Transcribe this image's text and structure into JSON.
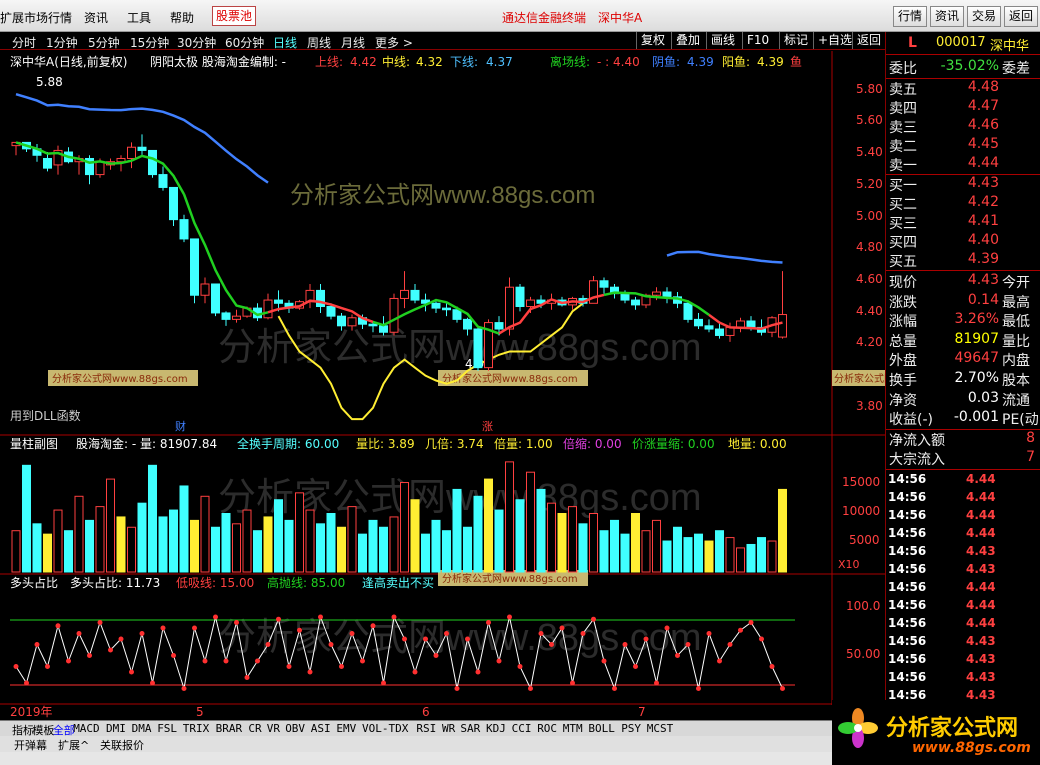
{
  "menu": {
    "items": [
      "扩展市场行情",
      "资讯",
      "工具",
      "帮助"
    ],
    "hot": "股票池",
    "center_app": "通达信金融终端",
    "center_stock": "深中华A",
    "right_btns": [
      "行情",
      "资讯",
      "交易",
      "返回"
    ]
  },
  "toolbar": {
    "periods": [
      "分时",
      "1分钟",
      "5分钟",
      "15分钟",
      "30分钟",
      "60分钟",
      "日线",
      "周线",
      "月线",
      "更多 >"
    ],
    "selected": "日线",
    "right": [
      "复权",
      "叠加",
      "画线",
      "F10",
      "标记",
      "+自选",
      "返回"
    ]
  },
  "main_title": {
    "name": "深中华A(日线,前复权)",
    "formula": "阴阳太极  股海淘金编制: -",
    "upper_label": "上线:",
    "upper": "4.42",
    "mid_label": "中线:",
    "mid": "4.32",
    "lower_label": "下线:",
    "lower": "4.37",
    "exit_label": "离场线:",
    "exit": "- : 4.40",
    "yin_label": "阴鱼:",
    "yin": "4.39",
    "yang_label": "阳鱼:",
    "yang": "4.39",
    "fish": "鱼"
  },
  "price_axis": [
    "5.80",
    "5.60",
    "5.40",
    "5.20",
    "5.00",
    "4.80",
    "4.60",
    "4.40",
    "4.20",
    "3.80"
  ],
  "annotations": {
    "high": "5.88",
    "low": "4.08",
    "dll": "用到DLL函数",
    "cai": "财",
    "zhang": "涨"
  },
  "watermark": {
    "text": "分析家公式网www.88gs.com",
    "big1": "分析家公式网www.88gs.com",
    "big2": "分析家公式网www.88gs.com",
    "small": "分析家公式网www.88gs.com"
  },
  "volume_title": {
    "name": "量柱副图",
    "formula": "股海淘金: - 量: 81907.84",
    "period": "全换手周期: 60.00",
    "ratio": "量比: 3.89",
    "times": "几倍: 3.74",
    "bei": "倍量: 1.00",
    "suo": "倍缩: 0.00",
    "jzl": "价涨量缩: 0.00",
    "dl": "地量: 0.00"
  },
  "volume_axis": [
    "15000",
    "10000",
    "5000"
  ],
  "volume_unit": "X10",
  "osc_title": {
    "name": "多头占比",
    "label": "多头占比: 11.73",
    "low": "低吸线: 15.00",
    "high": "高抛线: 85.00",
    "tip": "逢高卖出不买"
  },
  "osc_axis": [
    "100.0",
    "50.00"
  ],
  "dates": [
    "2019年",
    "5",
    "6",
    "7"
  ],
  "tabs": [
    "指标",
    "模板",
    "全部",
    "MACD",
    "DMI",
    "DMA",
    "FSL",
    "TRIX",
    "BRAR",
    "CR",
    "VR",
    "OBV",
    "ASI",
    "EMV",
    "VOL-TDX",
    "RSI",
    "WR",
    "SAR",
    "KDJ",
    "CCI",
    "ROC",
    "MTM",
    "BOLL",
    "PSY",
    "MCST"
  ],
  "tabs_active": "全部",
  "tabs2": [
    "开弹幕",
    "扩展^",
    "关联报价"
  ],
  "quote": {
    "code": "000017",
    "name": "深中华",
    "flag": "L",
    "weibi_label": "委比",
    "weibi": "-35.02%",
    "weicha": "委差",
    "asks": [
      {
        "l": "卖五",
        "p": "4.48"
      },
      {
        "l": "卖四",
        "p": "4.47"
      },
      {
        "l": "卖三",
        "p": "4.46"
      },
      {
        "l": "卖二",
        "p": "4.45"
      },
      {
        "l": "卖一",
        "p": "4.44"
      }
    ],
    "bids": [
      {
        "l": "买一",
        "p": "4.43"
      },
      {
        "l": "买二",
        "p": "4.42"
      },
      {
        "l": "买三",
        "p": "4.41"
      },
      {
        "l": "买四",
        "p": "4.40"
      },
      {
        "l": "买五",
        "p": "4.39"
      }
    ],
    "stats": [
      {
        "l": "现价",
        "v": "4.43",
        "c": "red",
        "x": "今开"
      },
      {
        "l": "涨跌",
        "v": "0.14",
        "c": "red",
        "x": "最高"
      },
      {
        "l": "涨幅",
        "v": "3.26%",
        "c": "red",
        "x": "最低"
      },
      {
        "l": "总量",
        "v": "81907",
        "c": "yel",
        "x": "量比"
      },
      {
        "l": "外盘",
        "v": "49647",
        "c": "red",
        "x": "内盘"
      },
      {
        "l": "换手",
        "v": "2.70%",
        "c": "wht",
        "x": "股本"
      },
      {
        "l": "净资",
        "v": "0.03",
        "c": "wht",
        "x": "流通"
      },
      {
        "l": "收益(-)",
        "v": "-0.001",
        "c": "wht",
        "x": "PE(动"
      }
    ],
    "flows": [
      {
        "l": "净流入额",
        "v": "8"
      },
      {
        "l": "大宗流入",
        "v": "7"
      }
    ],
    "ticks": [
      {
        "t": "14:56",
        "p": "4.44"
      },
      {
        "t": "14:56",
        "p": "4.44"
      },
      {
        "t": "14:56",
        "p": "4.44"
      },
      {
        "t": "14:56",
        "p": "4.44"
      },
      {
        "t": "14:56",
        "p": "4.43"
      },
      {
        "t": "14:56",
        "p": "4.43"
      },
      {
        "t": "14:56",
        "p": "4.44"
      },
      {
        "t": "14:56",
        "p": "4.44"
      },
      {
        "t": "14:56",
        "p": "4.44"
      },
      {
        "t": "14:56",
        "p": "4.43"
      },
      {
        "t": "14:56",
        "p": "4.43"
      },
      {
        "t": "14:56",
        "p": "4.43"
      },
      {
        "t": "14:56",
        "p": "4.43"
      },
      {
        "t": "14:56",
        "p": "4.43"
      }
    ]
  },
  "logo": {
    "cn": "分析家公式网",
    "url": "www.88gs.com"
  },
  "colors": {
    "up": "#ff4040",
    "down": "#40ffff",
    "blue": "#4080ff",
    "green": "#20d020",
    "yellow": "#ffee33"
  },
  "chart_data": {
    "type": "candlestick",
    "ylim": [
      3.7,
      5.95
    ],
    "candles": [
      [
        5.48,
        5.5,
        5.42,
        5.5
      ],
      [
        5.5,
        5.5,
        5.44,
        5.46
      ],
      [
        5.46,
        5.49,
        5.38,
        5.42
      ],
      [
        5.4,
        5.44,
        5.32,
        5.34
      ],
      [
        5.36,
        5.48,
        5.3,
        5.45
      ],
      [
        5.44,
        5.47,
        5.37,
        5.38
      ],
      [
        5.38,
        5.42,
        5.3,
        5.4
      ],
      [
        5.4,
        5.42,
        5.24,
        5.3
      ],
      [
        5.3,
        5.4,
        5.28,
        5.38
      ],
      [
        5.36,
        5.4,
        5.33,
        5.38
      ],
      [
        5.38,
        5.42,
        5.32,
        5.4
      ],
      [
        5.4,
        5.5,
        5.34,
        5.47
      ],
      [
        5.47,
        5.55,
        5.42,
        5.45
      ],
      [
        5.45,
        5.45,
        5.28,
        5.3
      ],
      [
        5.3,
        5.35,
        5.2,
        5.22
      ],
      [
        5.22,
        5.22,
        4.98,
        5.02
      ],
      [
        5.02,
        5.05,
        4.88,
        4.9
      ],
      [
        4.9,
        4.9,
        4.5,
        4.55
      ],
      [
        4.55,
        4.66,
        4.5,
        4.62
      ],
      [
        4.62,
        4.62,
        4.42,
        4.44
      ],
      [
        4.44,
        4.45,
        4.36,
        4.4
      ],
      [
        4.4,
        4.46,
        4.38,
        4.42
      ],
      [
        4.42,
        4.48,
        4.41,
        4.47
      ],
      [
        4.47,
        4.5,
        4.39,
        4.41
      ],
      [
        4.41,
        4.56,
        4.4,
        4.52
      ],
      [
        4.52,
        4.58,
        4.45,
        4.5
      ],
      [
        4.5,
        4.52,
        4.44,
        4.47
      ],
      [
        4.47,
        4.52,
        4.46,
        4.51
      ],
      [
        4.51,
        4.62,
        4.47,
        4.58
      ],
      [
        4.58,
        4.62,
        4.44,
        4.48
      ],
      [
        4.48,
        4.5,
        4.4,
        4.42
      ],
      [
        4.42,
        4.44,
        4.33,
        4.36
      ],
      [
        4.36,
        4.43,
        4.33,
        4.41
      ],
      [
        4.41,
        4.43,
        4.34,
        4.37
      ],
      [
        4.37,
        4.39,
        4.32,
        4.36
      ],
      [
        4.36,
        4.42,
        4.3,
        4.32
      ],
      [
        4.32,
        4.56,
        4.3,
        4.53
      ],
      [
        4.53,
        4.7,
        4.47,
        4.58
      ],
      [
        4.58,
        4.62,
        4.5,
        4.52
      ],
      [
        4.52,
        4.56,
        4.45,
        4.5
      ],
      [
        4.5,
        4.51,
        4.44,
        4.47
      ],
      [
        4.47,
        4.5,
        4.42,
        4.46
      ],
      [
        4.46,
        4.48,
        4.38,
        4.4
      ],
      [
        4.4,
        4.41,
        4.3,
        4.34
      ],
      [
        4.34,
        4.36,
        4.08,
        4.1
      ],
      [
        4.1,
        4.4,
        4.08,
        4.38
      ],
      [
        4.38,
        4.42,
        4.3,
        4.34
      ],
      [
        4.34,
        4.66,
        4.3,
        4.6
      ],
      [
        4.6,
        4.62,
        4.45,
        4.48
      ],
      [
        4.48,
        4.54,
        4.44,
        4.52
      ],
      [
        4.52,
        4.55,
        4.47,
        4.5
      ],
      [
        4.5,
        4.56,
        4.46,
        4.52
      ],
      [
        4.52,
        4.54,
        4.48,
        4.49
      ],
      [
        4.49,
        4.54,
        4.46,
        4.53
      ],
      [
        4.53,
        4.55,
        4.48,
        4.5
      ],
      [
        4.5,
        4.67,
        4.5,
        4.64
      ],
      [
        4.64,
        4.66,
        4.56,
        4.6
      ],
      [
        4.6,
        4.62,
        4.53,
        4.56
      ],
      [
        4.56,
        4.58,
        4.5,
        4.52
      ],
      [
        4.52,
        4.54,
        4.46,
        4.49
      ],
      [
        4.49,
        4.56,
        4.47,
        4.55
      ],
      [
        4.55,
        4.6,
        4.52,
        4.57
      ],
      [
        4.57,
        4.6,
        4.5,
        4.54
      ],
      [
        4.54,
        4.57,
        4.47,
        4.5
      ],
      [
        4.5,
        4.52,
        4.38,
        4.4
      ],
      [
        4.4,
        4.44,
        4.34,
        4.36
      ],
      [
        4.36,
        4.4,
        4.32,
        4.34
      ],
      [
        4.34,
        4.38,
        4.28,
        4.3
      ],
      [
        4.3,
        4.38,
        4.26,
        4.35
      ],
      [
        4.35,
        4.41,
        4.32,
        4.39
      ],
      [
        4.39,
        4.42,
        4.33,
        4.35
      ],
      [
        4.35,
        4.4,
        4.3,
        4.32
      ],
      [
        4.32,
        4.42,
        4.29,
        4.41
      ],
      [
        4.29,
        4.7,
        4.28,
        4.43
      ]
    ],
    "volume": [
      6000,
      15500,
      7000,
      5500,
      9000,
      6000,
      11000,
      7500,
      9500,
      13500,
      8000,
      6500,
      10000,
      15500,
      8000,
      9000,
      12500,
      7500,
      11000,
      6500,
      8500,
      7000,
      9000,
      6000,
      8000,
      10500,
      7500,
      11500,
      9000,
      7000,
      8500,
      6500,
      9500,
      5500,
      7500,
      6500,
      8000,
      13000,
      10500,
      5500,
      7500,
      6000,
      12000,
      6500,
      11000,
      13500,
      9000,
      16000,
      10500,
      14500,
      12000,
      10000,
      8500,
      9500,
      7000,
      8500,
      6000,
      7500,
      5500,
      8500,
      6000,
      7500,
      4500,
      6500,
      5000,
      5500,
      4500,
      6000,
      5000,
      3500,
      4000,
      5000,
      4500,
      12000
    ],
    "bull_ratio": [
      35,
      20,
      55,
      35,
      72,
      40,
      65,
      45,
      75,
      50,
      60,
      30,
      65,
      20,
      70,
      45,
      15,
      70,
      40,
      80,
      40,
      75,
      25,
      40,
      55,
      78,
      35,
      68,
      30,
      80,
      55,
      35,
      65,
      40,
      72,
      20,
      80,
      60,
      30,
      60,
      45,
      65,
      15,
      60,
      30,
      75,
      40,
      80,
      35,
      15,
      65,
      55,
      70,
      20,
      65,
      78,
      40,
      15,
      55,
      35,
      60,
      20,
      70,
      45,
      55,
      15,
      65,
      40,
      55,
      68,
      75,
      60,
      35,
      15
    ]
  }
}
